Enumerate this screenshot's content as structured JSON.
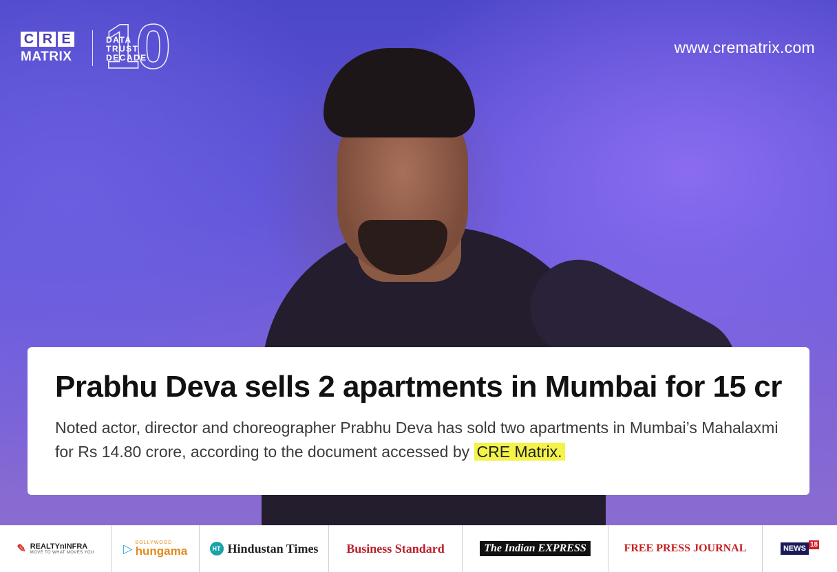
{
  "brand": {
    "logo_top": [
      "C",
      "R",
      "E"
    ],
    "logo_bottom": "MATRIX",
    "decade_number": "10",
    "decade_words": [
      "DATA",
      "TRUST",
      "DECADE"
    ],
    "website": "www.crematrix.com"
  },
  "article": {
    "headline": "Prabhu Deva sells 2 apartments in Mumbai for 15 cr",
    "body": "Noted actor, director and choreographer Prabhu Deva has sold two apartments in Mumbai’s Mahalaxmi for Rs 14.80 crore, according to the document accessed by",
    "highlight": "CRE Matrix."
  },
  "publications": {
    "realty": {
      "name": "REALTYnINFRA",
      "tagline": "MOVE TO WHAT MOVES YOU"
    },
    "bollywood": {
      "small": "BOLLYWOOD",
      "main": "hungama"
    },
    "ht": {
      "badge": "HT",
      "name": "Hindustan Times"
    },
    "bs": {
      "name": "Business Standard"
    },
    "ie": {
      "name": "The Indian EXPRESS"
    },
    "fpj": {
      "name": "FREE PRESS JOURNAL"
    },
    "news18": {
      "name": "NEWS",
      "number": "18"
    }
  },
  "colors": {
    "background_purple": "#4a3fb0",
    "highlight_yellow": "#f3f34a",
    "card_white": "#ffffff"
  }
}
